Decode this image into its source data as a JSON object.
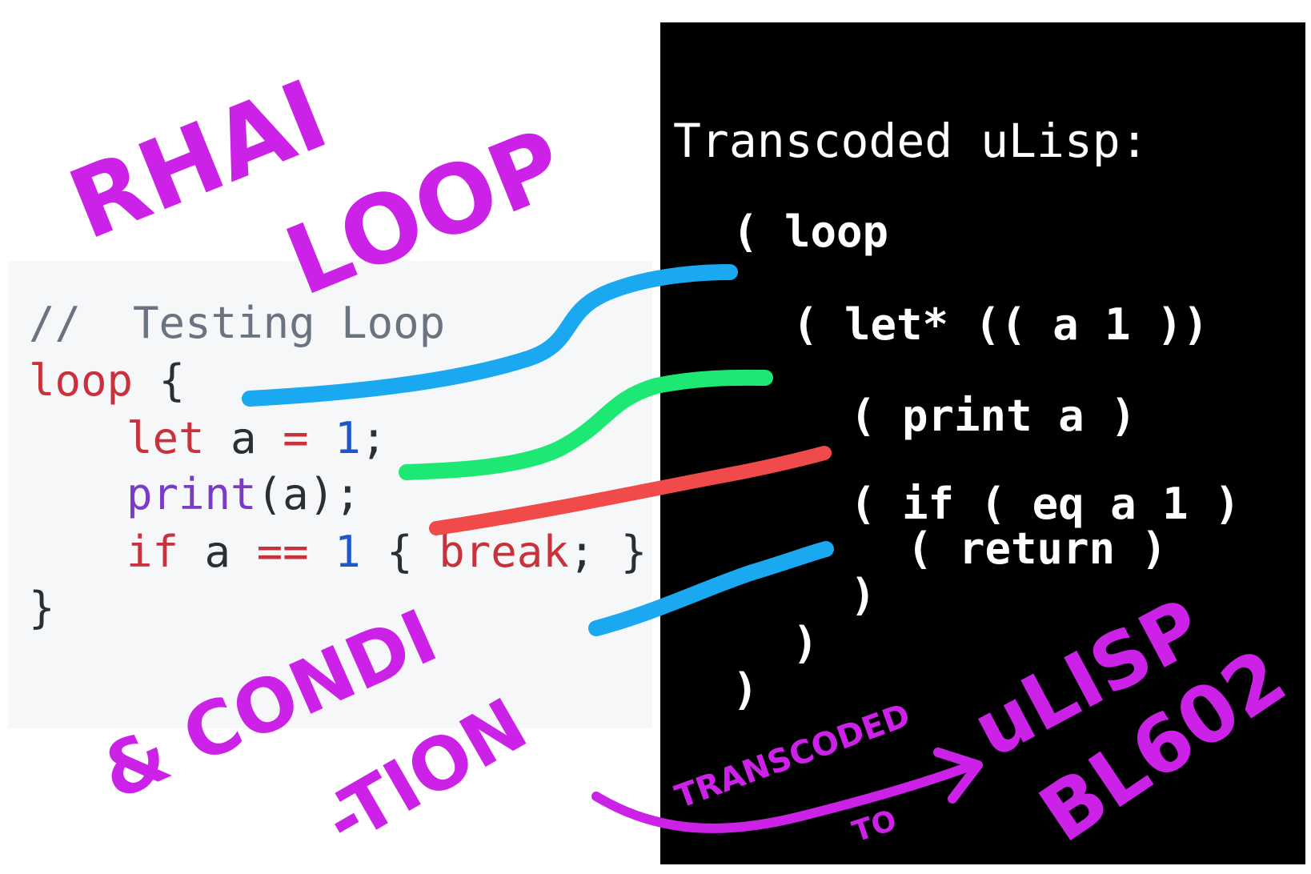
{
  "code": {
    "comment": "//  Testing Loop",
    "line_loop_kw": "loop",
    "line_loop_brace": " {",
    "let_kw": "let",
    "let_var": " a ",
    "let_eq": "=",
    "let_num": "1",
    "let_semi": ";",
    "print_fn": "print",
    "print_args": "(a);",
    "if_kw": "if",
    "if_var": " a ",
    "if_op": "==",
    "if_num": "1",
    "if_open": " { ",
    "if_break": "break",
    "if_close": "; }",
    "close_brace": "}"
  },
  "terminal": {
    "title": "Transcoded uLisp:",
    "lines": [
      "( loop",
      "( let* (( a 1 ))",
      "( print a )",
      "( if ( eq a 1 )",
      "( return )",
      ")",
      ")",
      ")"
    ]
  },
  "annotations": {
    "rhai": "RHAI",
    "loop": "LOOP",
    "and_condi": "& CONDI",
    "tion": "-TION",
    "transcoded": "TRANSCODED",
    "to": "TO",
    "ulisp": "uLISP",
    "bl602": "BL602"
  },
  "colors": {
    "annotation": "#cc22e8",
    "blue_line": "#1aa8f0",
    "green_line": "#1ee874",
    "red_line": "#f04a4a"
  }
}
